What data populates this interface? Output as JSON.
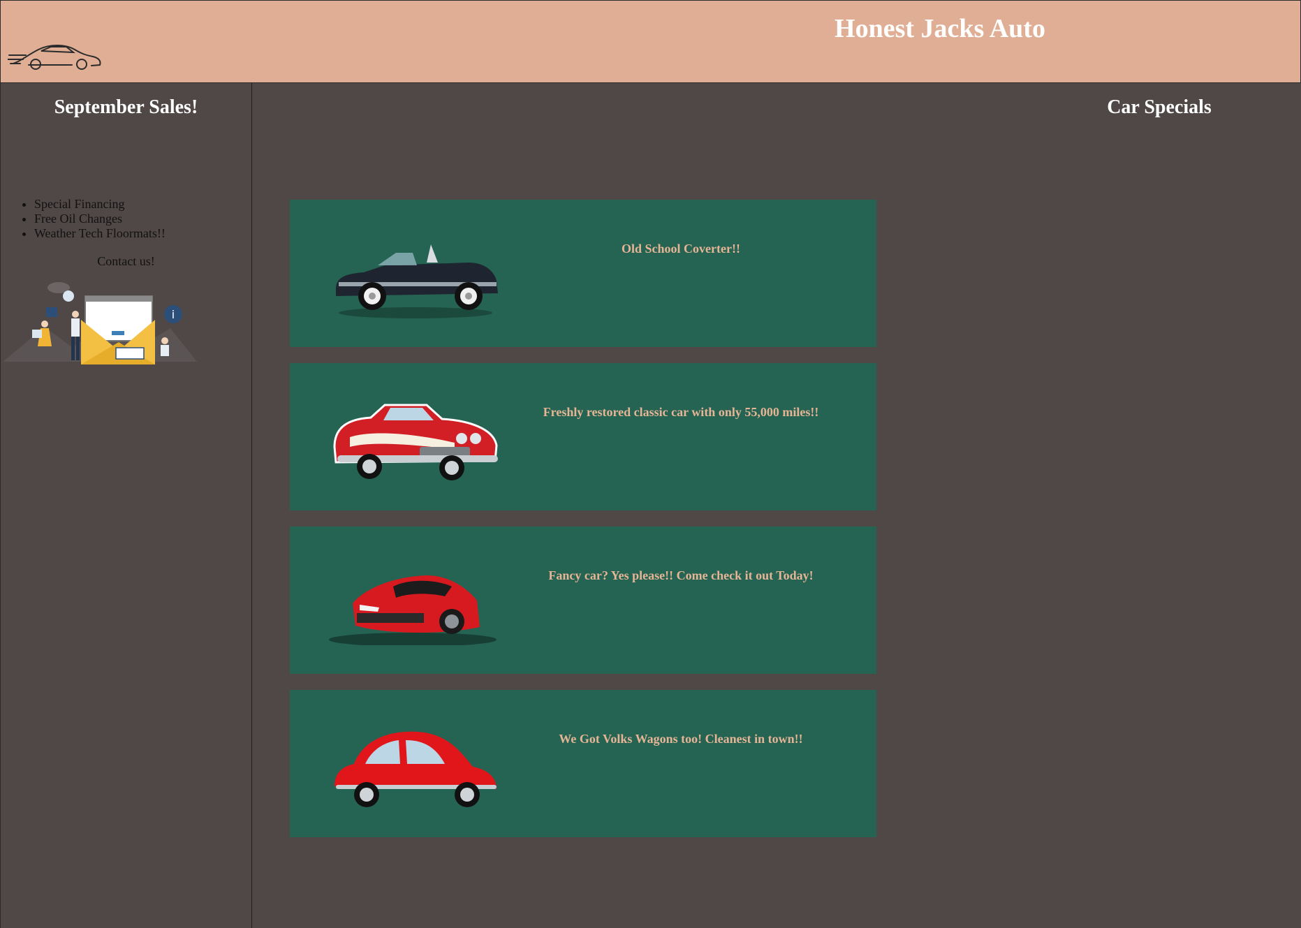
{
  "header": {
    "title": "Honest Jacks Auto",
    "logo_icon": "sports-car-outline-icon",
    "background": "#dfae94"
  },
  "sidebar": {
    "title": "September Sales!",
    "promotions": [
      "Special Financing",
      "Free Oil Changes",
      "Weather Tech Floormats!!"
    ],
    "contact_label": "Contact us!",
    "contact_illustration_icon": "contact-envelope-illustration"
  },
  "main": {
    "title": "Car Specials",
    "cards": [
      {
        "caption": "Old School Coverter!!",
        "image": "black-convertible-car",
        "color": "#1e2530"
      },
      {
        "caption": "Freshly restored classic car with only 55,000 miles!!",
        "image": "red-classic-car",
        "color": "#d21f26"
      },
      {
        "caption": "Fancy car? Yes please!! Come check it out Today!",
        "image": "red-sports-car",
        "color": "#d71a1f"
      },
      {
        "caption": "We Got Volks Wagons too! Cleanest in town!!",
        "image": "red-beetle-car",
        "color": "#e0161b"
      }
    ],
    "card_background": "#256352",
    "caption_color": "#e5b596"
  },
  "page_background": "#504747"
}
